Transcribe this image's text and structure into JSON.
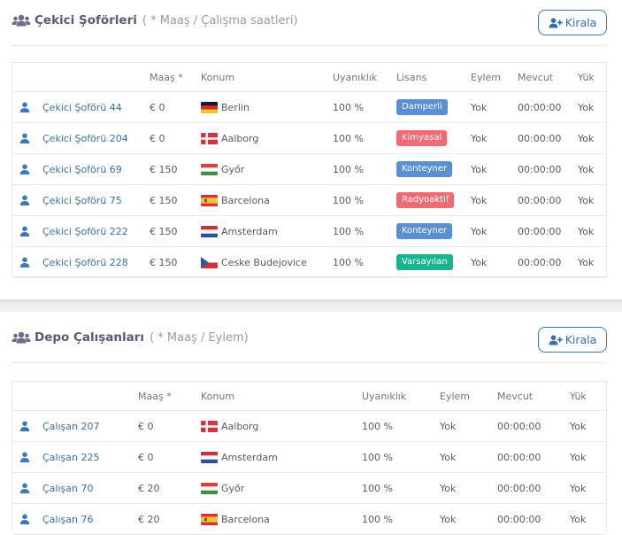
{
  "colors": {
    "blue_badge": "#5b8fd4",
    "red_badge": "#ef6b74",
    "green_badge": "#18b38f",
    "link": "#3a6fa8"
  },
  "drivers": {
    "title": "Çekici Şoförleri",
    "note": "( * Maaş / Çalışma saatleri)",
    "hire_label": "Kirala",
    "columns": [
      "Maaş *",
      "Konum",
      "Uyanıklık",
      "Lisans",
      "Eylem",
      "Mevcut",
      "Yük"
    ],
    "rows": [
      {
        "name": "Çekici Şoförü 44",
        "salary": "€ 0",
        "flag": "de",
        "location": "Berlin",
        "alert": "100 %",
        "license": "Damperli",
        "license_color": "blue",
        "action": "Yok",
        "current": "00:00:00",
        "load": "Yok"
      },
      {
        "name": "Çekici Şoförü 204",
        "salary": "€ 0",
        "flag": "dk",
        "location": "Aalborg",
        "alert": "100 %",
        "license": "Kimyasal",
        "license_color": "red",
        "action": "Yok",
        "current": "00:00:00",
        "load": "Yok"
      },
      {
        "name": "Çekici Şoförü 69",
        "salary": "€ 150",
        "flag": "hu",
        "location": "Győr",
        "alert": "100 %",
        "license": "Konteyner",
        "license_color": "blue",
        "action": "Yok",
        "current": "00:00:00",
        "load": "Yok"
      },
      {
        "name": "Çekici Şoförü 75",
        "salary": "€ 150",
        "flag": "es",
        "location": "Barcelona",
        "alert": "100 %",
        "license": "Radyoaktif",
        "license_color": "red",
        "action": "Yok",
        "current": "00:00:00",
        "load": "Yok"
      },
      {
        "name": "Çekici Şoförü 222",
        "salary": "€ 150",
        "flag": "nl",
        "location": "Amsterdam",
        "alert": "100 %",
        "license": "Konteyner",
        "license_color": "blue",
        "action": "Yok",
        "current": "00:00:00",
        "load": "Yok"
      },
      {
        "name": "Çekici Şoförü 228",
        "salary": "€ 150",
        "flag": "cz",
        "location": "Ceske Budejovice",
        "alert": "100 %",
        "license": "Varsayılan",
        "license_color": "green",
        "action": "Yok",
        "current": "00:00:00",
        "load": "Yok"
      }
    ]
  },
  "warehouse": {
    "title": "Depo Çalışanları",
    "note": "( * Maaş / Eylem)",
    "hire_label": "Kirala",
    "columns": [
      "Maaş *",
      "Konum",
      "Uyanıklık",
      "Eylem",
      "Mevcut",
      "Yük"
    ],
    "rows": [
      {
        "name": "Çalışan 207",
        "salary": "€ 0",
        "flag": "dk",
        "location": "Aalborg",
        "alert": "100 %",
        "action": "Yok",
        "current": "00:00:00",
        "load": "Yok"
      },
      {
        "name": "Çalışan 225",
        "salary": "€ 0",
        "flag": "nl",
        "location": "Amsterdam",
        "alert": "100 %",
        "action": "Yok",
        "current": "00:00:00",
        "load": "Yok"
      },
      {
        "name": "Çalışan 70",
        "salary": "€ 20",
        "flag": "hu",
        "location": "Győr",
        "alert": "100 %",
        "action": "Yok",
        "current": "00:00:00",
        "load": "Yok"
      },
      {
        "name": "Çalışan 76",
        "salary": "€ 20",
        "flag": "es",
        "location": "Barcelona",
        "alert": "100 %",
        "action": "Yok",
        "current": "00:00:00",
        "load": "Yok"
      }
    ]
  }
}
